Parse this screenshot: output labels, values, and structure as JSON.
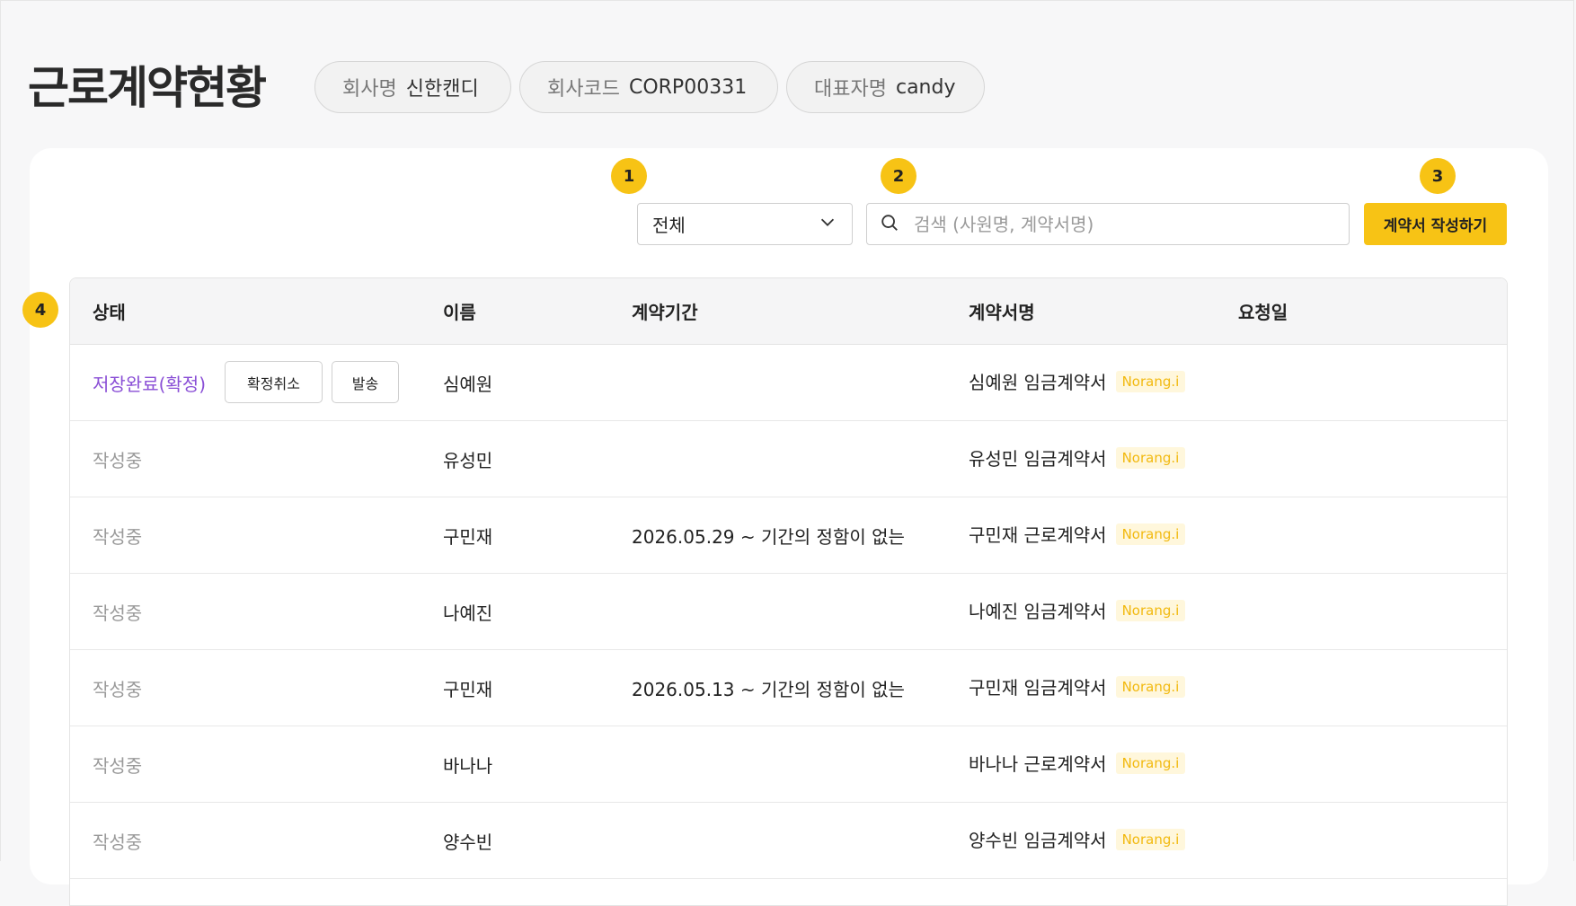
{
  "header": {
    "title": "근로계약현황",
    "company": {
      "label": "회사명",
      "value": "신한캔디"
    },
    "code": {
      "label": "회사코드",
      "value": "CORP00331"
    },
    "ceo": {
      "label": "대표자명",
      "value": "candy"
    }
  },
  "markers": [
    "1",
    "2",
    "3",
    "4"
  ],
  "toolbar": {
    "filter_value": "전체",
    "search_placeholder": "검색 (사원명, 계약서명)",
    "create_label": "계약서 작성하기"
  },
  "table": {
    "columns": [
      "상태",
      "이름",
      "계약기간",
      "계약서명",
      "요청일"
    ],
    "rows": [
      {
        "status": "저장완료(확정)",
        "name": "심예원",
        "period": "",
        "contract": "심예원 임금계약서",
        "tag": "Norang.i",
        "actions": [
          "확정취소",
          "발송"
        ]
      },
      {
        "status": "작성중",
        "name": "유성민",
        "period": "",
        "contract": "유성민 임금계약서",
        "tag": "Norang.i"
      },
      {
        "status": "작성중",
        "name": "구민재",
        "period": "2026.05.29 ~ 기간의 정함이 없는",
        "contract": "구민재 근로계약서",
        "tag": "Norang.i"
      },
      {
        "status": "작성중",
        "name": "나예진",
        "period": "",
        "contract": "나예진 임금계약서",
        "tag": "Norang.i"
      },
      {
        "status": "작성중",
        "name": "구민재",
        "period": "2026.05.13 ~ 기간의 정함이 없는",
        "contract": "구민재 임금계약서",
        "tag": "Norang.i"
      },
      {
        "status": "작성중",
        "name": "바나나",
        "period": "",
        "contract": "바나나 근로계약서",
        "tag": "Norang.i"
      },
      {
        "status": "작성중",
        "name": "양수빈",
        "period": "",
        "contract": "양수빈 임금계약서",
        "tag": "Norang.i"
      }
    ]
  },
  "colors": {
    "accent": "#f7c315",
    "status_done": "#8a4fd6",
    "status_draft": "#9a9a9a",
    "tag_text": "#f2b90f"
  }
}
